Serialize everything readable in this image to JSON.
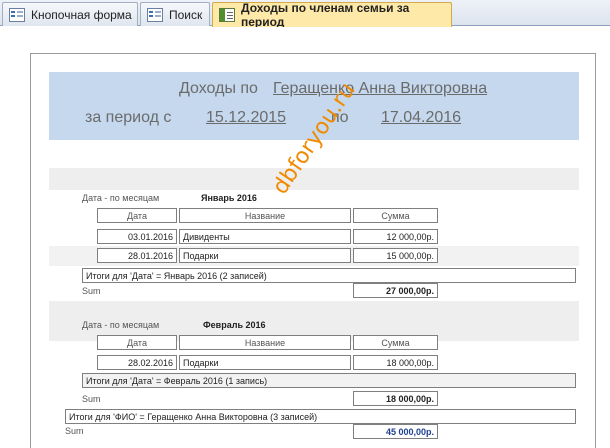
{
  "tabs": [
    {
      "label": "Кнопочная форма",
      "icon": "form-icon"
    },
    {
      "label": "Поиск",
      "icon": "form-icon"
    },
    {
      "label": "Доходы по членам семьи за период",
      "icon": "report-icon"
    }
  ],
  "report": {
    "title_prefix": "Доходы по",
    "person": "Геращенко Анна Викторовна",
    "period_label": "за период с",
    "date_from": "15.12.2015",
    "to_label": "по",
    "date_to": "17.04.2016"
  },
  "watermark": "dbforyou.ru",
  "groups": [
    {
      "group_label": "Дата - по месяцам",
      "month": "Январь 2016",
      "headers": [
        "Дата",
        "Название",
        "Сумма"
      ],
      "rows": [
        {
          "date": "03.01.2016",
          "name": "Дивиденты",
          "sum": "12 000,00р."
        },
        {
          "date": "28.01.2016",
          "name": "Подарки",
          "sum": "15 000,00р."
        }
      ],
      "total_text": "Итоги для 'Дата' =  Январь 2016 (2 записей)",
      "sum_label": "Sum",
      "sum_value": "27 000,00р."
    },
    {
      "group_label": "Дата - по месяцам",
      "month": "Февраль 2016",
      "headers": [
        "Дата",
        "Название",
        "Сумма"
      ],
      "rows": [
        {
          "date": "28.02.2016",
          "name": "Подарки",
          "sum": "18 000,00р."
        }
      ],
      "total_text": "Итоги для 'Дата' =  Февраль 2016 (1 запись)",
      "sum_label": "Sum",
      "sum_value": "18 000,00р."
    }
  ],
  "fio_total": {
    "text": "Итоги для 'ФИО' =  Геращенко Анна Викторовна (3 записей)",
    "sum_label": "Sum",
    "sum_value": "45 000,00р."
  }
}
